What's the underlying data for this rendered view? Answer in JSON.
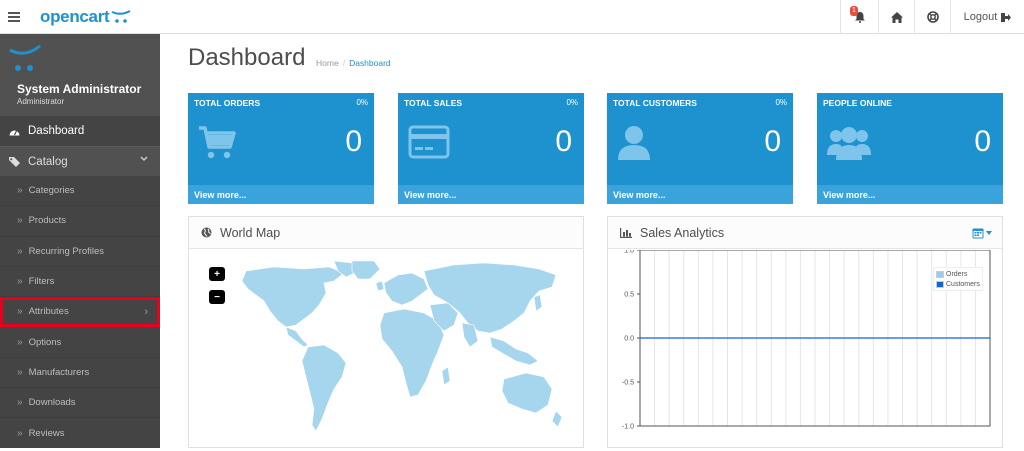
{
  "header": {
    "logo_text": "opencart",
    "alert_count": "1",
    "logout_label": "Logout"
  },
  "sidebar": {
    "user_name": "System Administrator",
    "user_role": "Administrator",
    "dashboard_label": "Dashboard",
    "catalog_label": "Catalog",
    "catalog_items": [
      {
        "label": "Categories"
      },
      {
        "label": "Products"
      },
      {
        "label": "Recurring Profiles"
      },
      {
        "label": "Filters"
      },
      {
        "label": "Attributes"
      },
      {
        "label": "Options"
      },
      {
        "label": "Manufacturers"
      },
      {
        "label": "Downloads"
      },
      {
        "label": "Reviews"
      }
    ]
  },
  "main": {
    "title": "Dashboard",
    "breadcrumb": [
      "Home",
      "/",
      "Dashboard"
    ],
    "tiles": [
      {
        "title": "TOTAL ORDERS",
        "pct": "0%",
        "value": "0",
        "footer": "View more...",
        "icon": "cart-icon"
      },
      {
        "title": "TOTAL SALES",
        "pct": "0%",
        "value": "0",
        "footer": "View more...",
        "icon": "credit-card-icon"
      },
      {
        "title": "TOTAL CUSTOMERS",
        "pct": "0%",
        "value": "0",
        "footer": "View more...",
        "icon": "user-icon"
      },
      {
        "title": "PEOPLE ONLINE",
        "pct": "",
        "value": "0",
        "footer": "View more...",
        "icon": "users-icon"
      }
    ],
    "world_map": {
      "title": "World Map",
      "zoom_in": "+",
      "zoom_out": "−"
    },
    "sales_analytics": {
      "title": "Sales Analytics",
      "y_ticks": [
        "1.0",
        "0.5",
        "0.0",
        "-0.5",
        "-1.0"
      ],
      "legend": [
        {
          "name": "Orders",
          "color": "#9acbe8"
        },
        {
          "name": "Customers",
          "color": "#1065d2"
        }
      ]
    }
  },
  "colors": {
    "brand": "#1e91cf",
    "sidebar": "#515151",
    "highlight": "#e8001c"
  }
}
